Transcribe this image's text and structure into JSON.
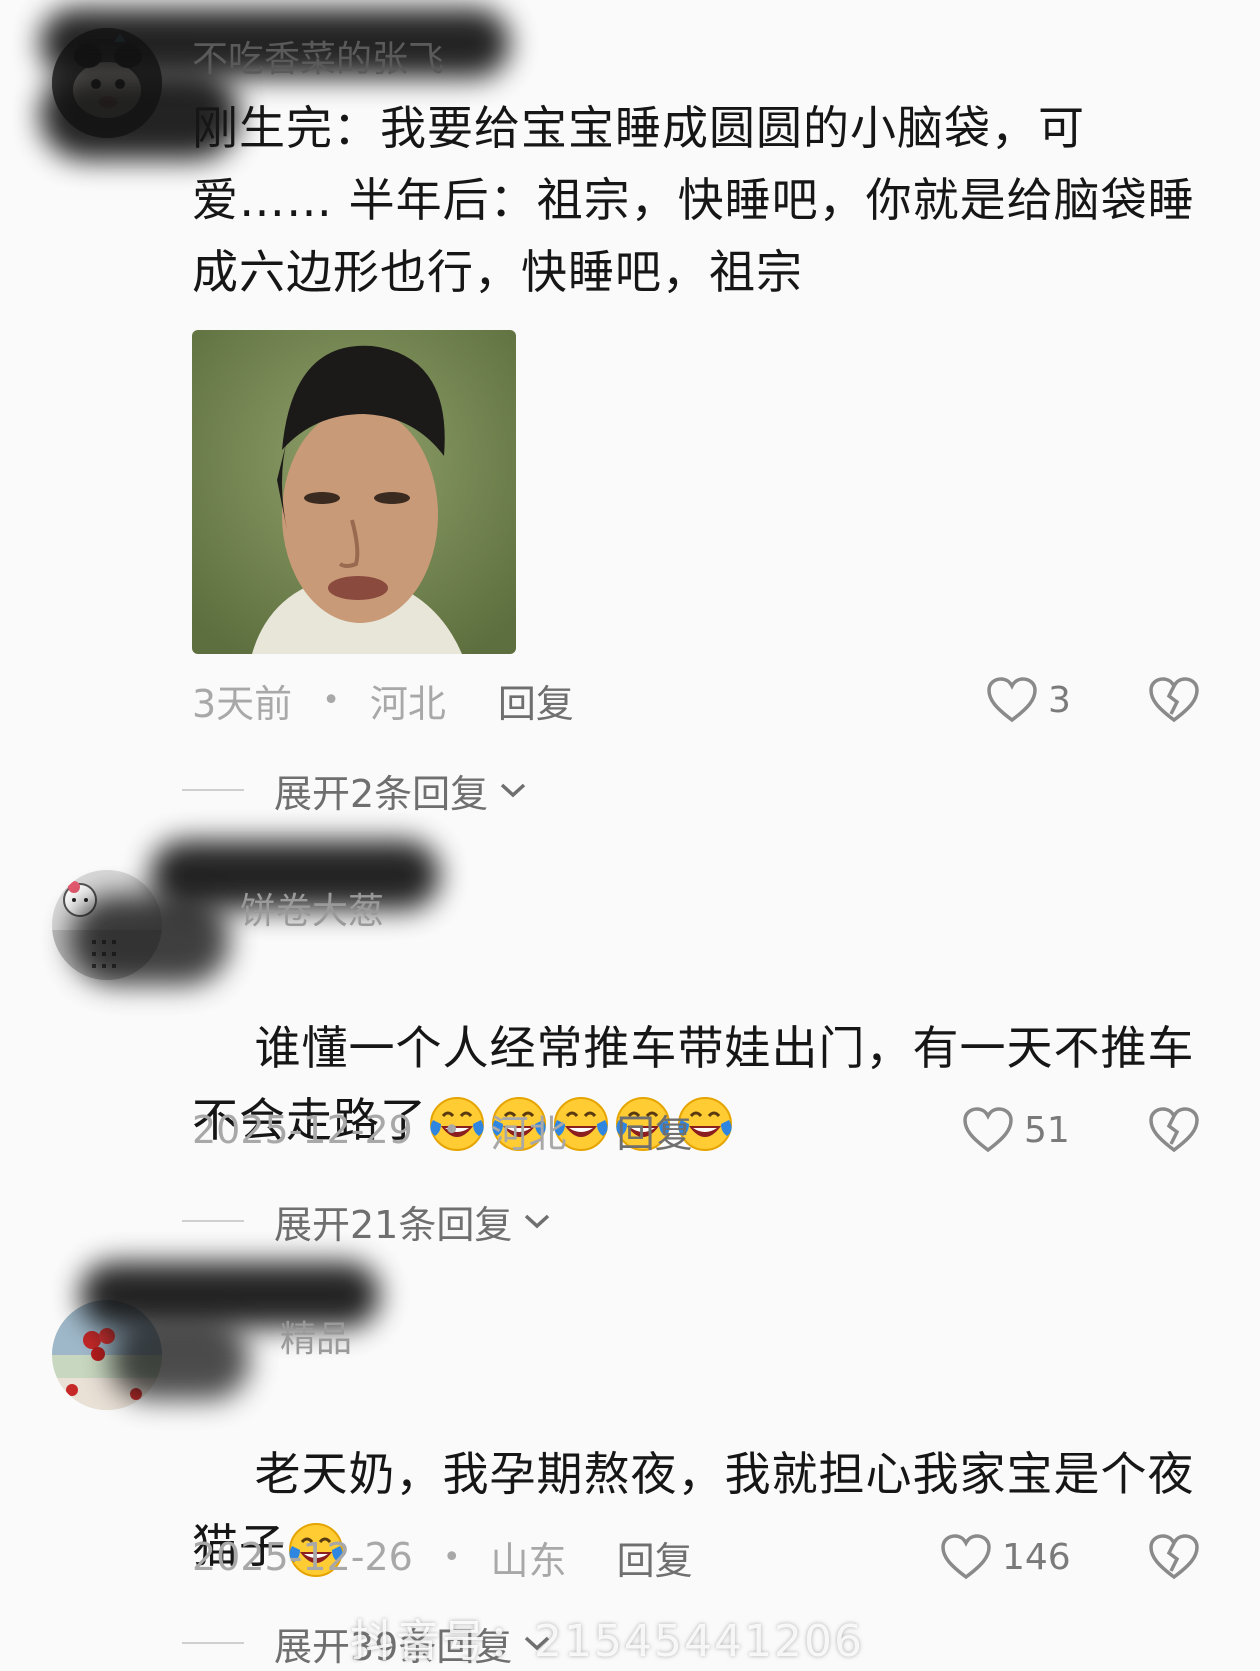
{
  "comments": [
    {
      "username": "不吃香菜的张飞",
      "text": "刚生完：我要给宝宝睡成圆圆的小脑袋，可爱…… 半年后：祖宗，快睡吧，你就是给脑袋睡成六边形也行，快睡吧，祖宗",
      "time": "3天前",
      "location": "河北",
      "reply_label": "回复",
      "likes": "3",
      "expand_label": "展开2条回复"
    },
    {
      "username": "饼卷大葱",
      "text": "谁懂一个人经常推车带娃出门，有一天不推车不会走路了",
      "emoji_count": 5,
      "time": "2025-12-29",
      "location": "河北",
      "reply_label": "回复",
      "likes": "51",
      "expand_label": "展开21条回复"
    },
    {
      "username": "精品",
      "text": "老天奶，我孕期熬夜，我就担心我家宝是个夜猫子",
      "emoji_count": 1,
      "time": "2025-12-26",
      "location": "山东",
      "reply_label": "回复",
      "likes": "146",
      "expand_label": "展开39条回复"
    }
  ],
  "watermark": "抖音号：21545441206",
  "icons": {
    "like": "heart-outline-icon",
    "dislike": "broken-heart-icon",
    "expand": "chevron-down-icon",
    "emoji": "laughing-crying-emoji"
  }
}
